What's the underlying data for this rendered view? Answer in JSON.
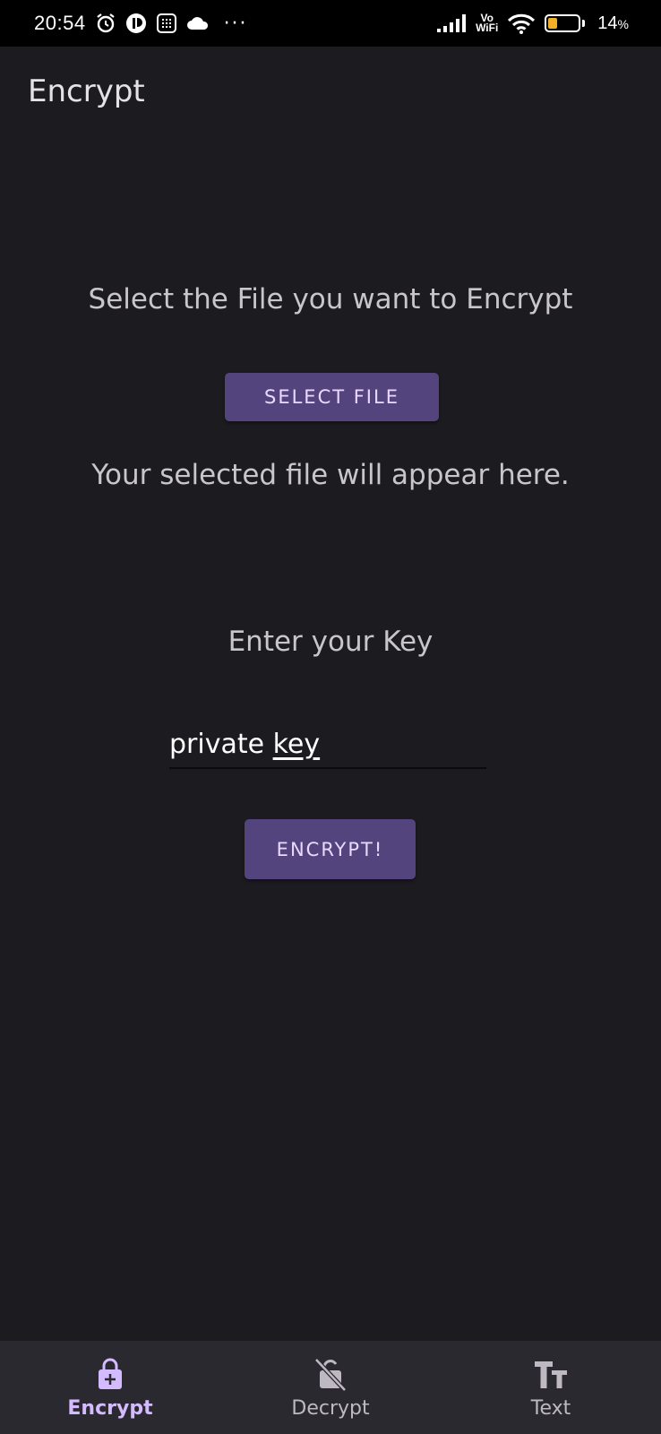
{
  "status_bar": {
    "time": "20:54",
    "icons": [
      "alarm-icon",
      "app-notification-icon",
      "calendar-icon",
      "cloud-icon",
      "more-dots-icon",
      "signal-icon",
      "vowifi-icon",
      "wifi-icon",
      "battery-icon"
    ],
    "more": "···",
    "vowifi_top": "Vo",
    "vowifi_bottom": "WiFi",
    "battery_percent": "14",
    "battery_unit": "%",
    "battery_level": 0.14
  },
  "app_bar": {
    "title": "Encrypt"
  },
  "main": {
    "select_prompt": "Select the File you want to Encrypt",
    "select_button": "SELECT FILE",
    "file_placeholder": "Your selected file will appear here.",
    "key_prompt": "Enter your Key",
    "key_value_plain": "private ",
    "key_value_underlined": "key",
    "encrypt_button": "ENCRYPT!"
  },
  "bottom_nav": {
    "items": [
      {
        "label": "Encrypt",
        "icon": "lock-add-icon",
        "active": true
      },
      {
        "label": "Decrypt",
        "icon": "lock-off-icon",
        "active": false
      },
      {
        "label": "Text",
        "icon": "text-fields-icon",
        "active": false
      }
    ]
  },
  "colors": {
    "background": "#1c1b20",
    "button": "#54447d",
    "button_text": "#ead9ff",
    "nav_background": "#2b2930",
    "nav_active": "#d4bbff",
    "battery_fill": "#f2b02a"
  }
}
